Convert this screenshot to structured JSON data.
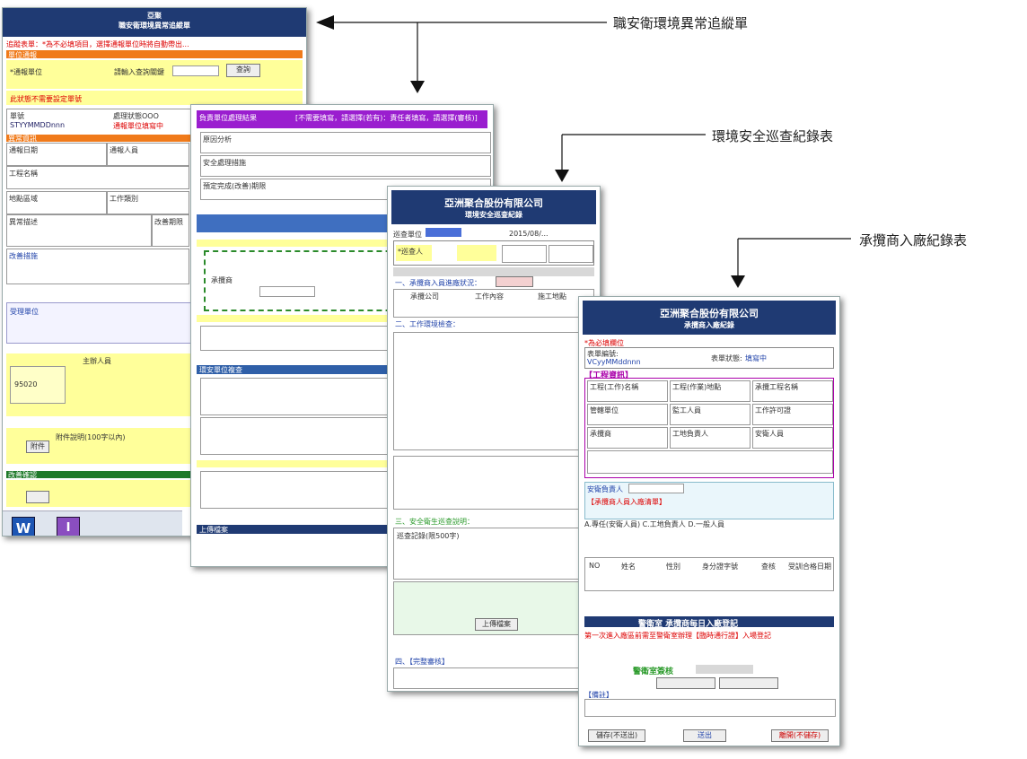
{
  "callouts": {
    "form1_label": "職安衛環境異常追縱單",
    "form2_label": "環境安全巡查紀錄表",
    "form3_label": "承攬商入廠紀錄表"
  },
  "form1": {
    "title_line1": "亞聚",
    "title_line2": "職安衛環境異常追縱單",
    "notice": "追蹤表單：*為不必填項目，選擇通報單位時將自動帶出...",
    "section_report": "單位通報",
    "unit_label": "*通報單位",
    "find_label": "請輸入查詢關鍵",
    "query_button": "查詢",
    "no_item": "此狀態不需要設定單號",
    "no_label": "單號",
    "no_value": "STYYMMDDnnn",
    "status_label": "處理狀態OOO",
    "status_value": "通報單位填寫中",
    "section_basic": "異常資訊",
    "f_date": "通報日期",
    "f_person": "通報人員",
    "f_project": "工程名稱",
    "f_location": "地點區域",
    "f_item": "工作類別",
    "f_desc": "異常描述",
    "f_fix": "改善期限",
    "f_measure": "改善措施",
    "section_confirm": "改善確認",
    "dept_label": "受理單位",
    "dept_value": "主辦人員",
    "code_value": "95020",
    "upload_button": "附件",
    "upload_label": "附件說明(100字以內)"
  },
  "form1b": {
    "header_left": "負責單位處理結果",
    "header_right": "[不需要填寫，請選擇(若有)：責任者填寫，請選擇(審核)]",
    "field1": "原因分析",
    "field2": "安全處理措施",
    "field3": "預定完成(改善)期限",
    "field4": "承攬商",
    "field5": "環安單位複查",
    "footer": "上傳檔案"
  },
  "form2": {
    "company": "亞洲聚合股份有限公司",
    "title": "環境安全巡查紀錄",
    "date_value": "2015/08/...",
    "unit_label": "巡查單位",
    "inspector_label": "*巡查人",
    "section1": "一、承攬商入員進廠狀況：",
    "section2": "二、工作環境檢查：",
    "section3": "三、安全衛生巡查說明：",
    "col1": "承攬公司",
    "col2": "工作內容",
    "col3": "施工地點",
    "remarks": "巡查記錄(限500字)",
    "upload": "上傳檔案",
    "section4": "四、【完整審核】"
  },
  "form3": {
    "company": "亞洲聚合股份有限公司",
    "title": "承攬商入廠紀錄",
    "required_note": "*為必填欄位",
    "no_label": "表單編號:",
    "no_value": "VCyyMMddnnn",
    "status_label": "表單狀態:",
    "status_value": "填寫中",
    "section_work": "【工程資訊】",
    "f1": "工程(工作)名稱",
    "f2": "工程(作業)地點",
    "f3": "承攬工程名稱",
    "f4": "管轄單位",
    "f5": "監工人員",
    "f6": "工作許可證",
    "f7": "承攬商",
    "f8": "工地負責人",
    "f9": "安衛人員",
    "safety_label": "安衛負責人",
    "people_label": "【承攬商人員入廠清單】",
    "people_hint": "A.專任(安衛人員) C.工地負責人 D.一般人員",
    "col_no": "NO",
    "col_name": "姓名",
    "col_type": "性別",
    "col_id": "身分證字號",
    "col_check": "查核",
    "col_note": "受訓合格日期",
    "gate_section": "警衛室 承攬商每日入廠登記",
    "gate_hint": "第一次進入廠區前需至警衛室辦理【臨時通行證】入場登記",
    "sign_label": "警衛室簽核",
    "remarks_label": "【備註】",
    "btn_save": "儲存(不送出)",
    "btn_submit": "送出",
    "btn_leave": "離開(不儲存)"
  }
}
